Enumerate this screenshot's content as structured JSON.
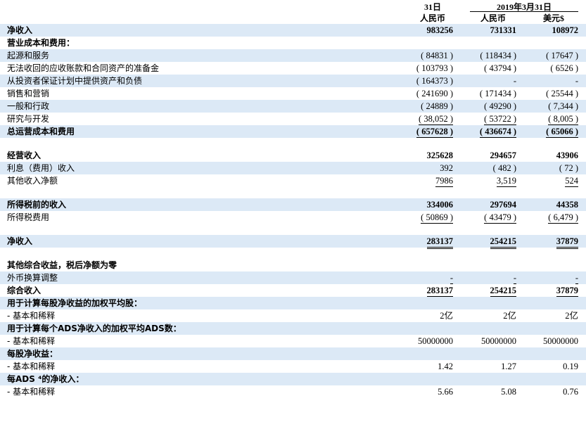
{
  "header": {
    "group1": "31日",
    "group2": "2019年3月31日",
    "col1": "人民币",
    "col2": "人民币",
    "col3": "美元$"
  },
  "rows": [
    {
      "label": "净收入",
      "v": [
        "983256",
        "731331",
        "108972"
      ],
      "bold": true,
      "shade": true
    },
    {
      "label": "营业成本和费用：",
      "v": [
        "",
        "",
        ""
      ],
      "bold": true,
      "shade": false
    },
    {
      "label": "起源和服务",
      "v": [
        "( 84831 )",
        "( 118434 )",
        "( 17647 )"
      ],
      "shade": true
    },
    {
      "label": "无法收回的应收账款和合同资产的准备金",
      "v": [
        "( 103793 )",
        "( 43794 )",
        "( 6526 )"
      ],
      "shade": false
    },
    {
      "label": "从投资者保证计划中提供资产和负债",
      "v": [
        "( 164373 )",
        "-",
        "-"
      ],
      "shade": true
    },
    {
      "label": "销售和营销",
      "v": [
        "( 241690 )",
        "( 171434 )",
        "( 25544 )"
      ],
      "shade": false
    },
    {
      "label": "一般和行政",
      "v": [
        "( 24889 )",
        "( 49290 )",
        "( 7,344 )"
      ],
      "shade": true
    },
    {
      "label": "研究与开发",
      "v": [
        "( 38,052 )",
        "( 53722 )",
        "( 8,005 )"
      ],
      "shade": false,
      "ul": 1
    },
    {
      "label": "总运营成本和费用",
      "v": [
        "( 657628 )",
        "( 436674 )",
        "( 65066 )"
      ],
      "bold": true,
      "shade": true,
      "ul": 1
    },
    {
      "spacer": true
    },
    {
      "label": "经营收入",
      "v": [
        "325628",
        "294657",
        "43906"
      ],
      "bold": true,
      "shade": false
    },
    {
      "label": "利息（费用）收入",
      "v": [
        "392",
        "( 482 )",
        "( 72 )"
      ],
      "shade": true
    },
    {
      "label": "其他收入净额",
      "v": [
        "7986",
        "3,519",
        "524"
      ],
      "shade": false,
      "ul": 1
    },
    {
      "spacer": true
    },
    {
      "label": "所得税前的收入",
      "v": [
        "334006",
        "297694",
        "44358"
      ],
      "bold": true,
      "shade": true
    },
    {
      "label": "所得税费用",
      "v": [
        "( 50869 )",
        "( 43479 )",
        "( 6,479 )"
      ],
      "shade": false,
      "ul": 1
    },
    {
      "spacer": true
    },
    {
      "label": "净收入",
      "v": [
        "283137",
        "254215",
        "37879"
      ],
      "bold": true,
      "shade": true,
      "ul": 2
    },
    {
      "spacer": true
    },
    {
      "label": "其他综合收益，税后净额为零",
      "v": [
        "",
        "",
        ""
      ],
      "bold": true,
      "shade": false
    },
    {
      "label": "外币换算调整",
      "v": [
        "-",
        "-",
        "-"
      ],
      "shade": true,
      "ul": 1
    },
    {
      "label": "综合收入",
      "v": [
        "283137",
        "254215",
        "37879"
      ],
      "bold": true,
      "shade": false,
      "ul": 2
    },
    {
      "label": "用于计算每股净收益的加权平均股：",
      "v": [
        "",
        "",
        ""
      ],
      "bold": true,
      "shade": true
    },
    {
      "label": "- 基本和稀释",
      "v": [
        "2亿",
        "2亿",
        "2亿"
      ],
      "shade": false
    },
    {
      "label": "用于计算每个ADS净收入的加权平均ADS数：",
      "v": [
        "",
        "",
        ""
      ],
      "bold": true,
      "shade": true
    },
    {
      "label": "- 基本和稀释",
      "v": [
        "50000000",
        "50000000",
        "50000000"
      ],
      "shade": false
    },
    {
      "label": "每股净收益：",
      "v": [
        "",
        "",
        ""
      ],
      "bold": true,
      "shade": true
    },
    {
      "label": "- 基本和稀释",
      "v": [
        "1.42",
        "1.27",
        "0.19"
      ],
      "shade": false
    },
    {
      "label": "每ADS ⁴的净收入：",
      "v": [
        "",
        "",
        ""
      ],
      "bold": true,
      "shade": true
    },
    {
      "label": "- 基本和稀释",
      "v": [
        "5.66",
        "5.08",
        "0.76"
      ],
      "shade": false
    }
  ]
}
